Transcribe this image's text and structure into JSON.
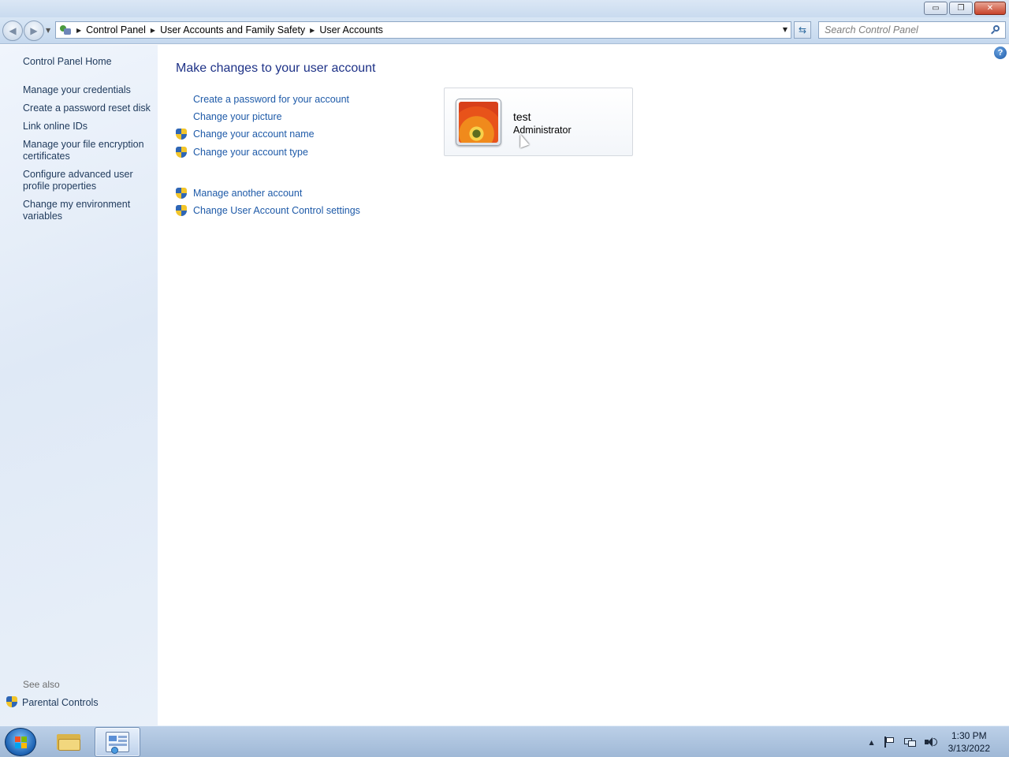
{
  "window": {
    "buttons": {
      "minimize": "▭",
      "restore": "❐",
      "close": "✕"
    }
  },
  "address": {
    "breadcrumbs": [
      "Control Panel",
      "User Accounts and Family Safety",
      "User Accounts"
    ],
    "search_placeholder": "Search Control Panel"
  },
  "sidebar": {
    "home": "Control Panel Home",
    "items": [
      "Manage your credentials",
      "Create a password reset disk",
      "Link online IDs",
      "Manage your file encryption certificates",
      "Configure advanced user profile properties",
      "Change my environment variables"
    ],
    "see_also_label": "See also",
    "see_also_items": [
      "Parental Controls"
    ]
  },
  "main": {
    "title": "Make changes to your user account",
    "tasks": [
      {
        "label": "Create a password for your account",
        "shield": false
      },
      {
        "label": "Change your picture",
        "shield": false
      },
      {
        "label": "Change your account name",
        "shield": true
      },
      {
        "label": "Change your account type",
        "shield": true
      }
    ],
    "other_tasks": [
      {
        "label": "Manage another account",
        "shield": true
      },
      {
        "label": "Change User Account Control settings",
        "shield": true
      }
    ],
    "account": {
      "name": "test",
      "role": "Administrator"
    },
    "help": "?"
  },
  "taskbar": {
    "clock_time": "1:30 PM",
    "clock_date": "3/13/2022"
  },
  "colors": {
    "link": "#1e5aa8",
    "title": "#1e3287",
    "sidebar_link": "#1e395b"
  },
  "icons": [
    "back-icon",
    "forward-icon",
    "control-panel-icon",
    "refresh-icon",
    "search-icon",
    "uac-shield-icon",
    "help-icon",
    "windows-start-icon",
    "folder-icon",
    "action-center-flag-icon",
    "network-icon",
    "volume-icon"
  ]
}
